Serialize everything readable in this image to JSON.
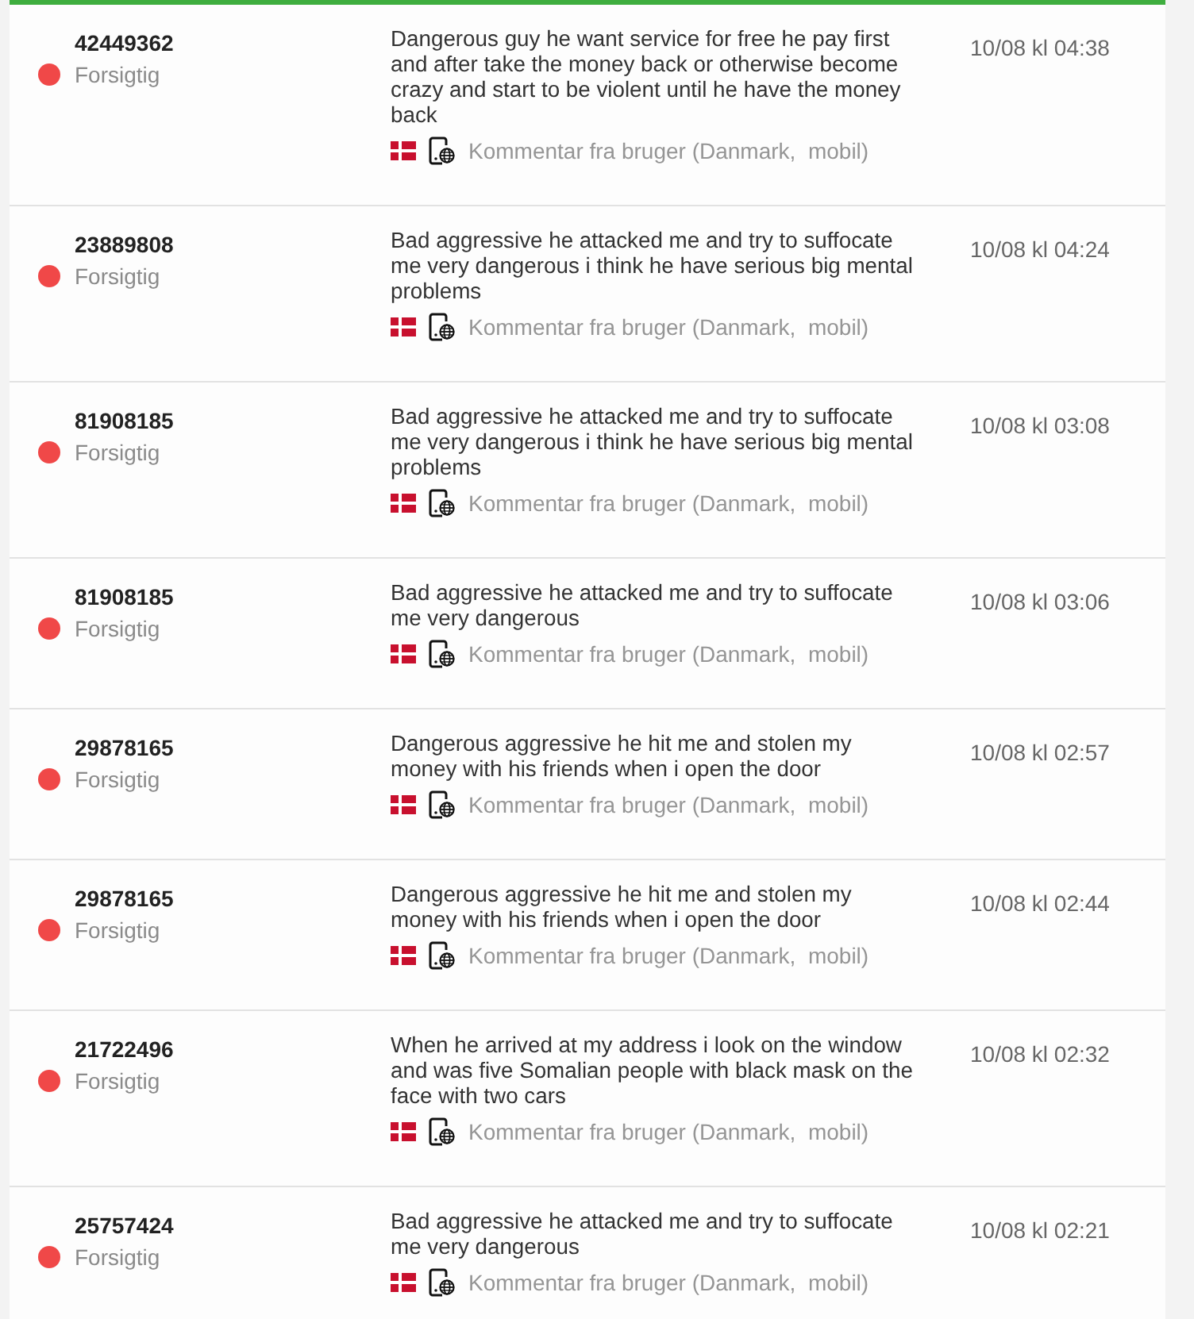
{
  "rows": [
    {
      "id": "42449362",
      "status": {
        "label": "Forsigtig",
        "color": "#f04848"
      },
      "comment": "Dangerous guy he want service for free he pay first and after take the money back or otherwise become crazy and start to be violent until he have the money back",
      "source": "Kommentar fra bruger (Danmark,  mobil)",
      "time": "10/08 kl 04:38"
    },
    {
      "id": "23889808",
      "status": {
        "label": "Forsigtig",
        "color": "#f04848"
      },
      "comment": "Bad aggressive he attacked me and try to suffocate me very dangerous i think he have serious big mental problems",
      "source": "Kommentar fra bruger (Danmark,  mobil)",
      "time": "10/08 kl 04:24"
    },
    {
      "id": "81908185",
      "status": {
        "label": "Forsigtig",
        "color": "#f04848"
      },
      "comment": "Bad aggressive he attacked me and try to suffocate me very dangerous i think he have serious big mental problems",
      "source": "Kommentar fra bruger (Danmark,  mobil)",
      "time": "10/08 kl 03:08"
    },
    {
      "id": "81908185",
      "status": {
        "label": "Forsigtig",
        "color": "#f04848"
      },
      "comment": "Bad aggressive he attacked me and try to suffocate me very dangerous",
      "source": "Kommentar fra bruger (Danmark,  mobil)",
      "time": "10/08 kl 03:06"
    },
    {
      "id": "29878165",
      "status": {
        "label": "Forsigtig",
        "color": "#f04848"
      },
      "comment": "Dangerous aggressive he hit me and stolen my money with his friends when i open the door",
      "source": "Kommentar fra bruger (Danmark,  mobil)",
      "time": "10/08 kl 02:57"
    },
    {
      "id": "29878165",
      "status": {
        "label": "Forsigtig",
        "color": "#f04848"
      },
      "comment": "Dangerous aggressive he hit me and stolen my money with his friends when i open the door",
      "source": "Kommentar fra bruger (Danmark,  mobil)",
      "time": "10/08 kl 02:44"
    },
    {
      "id": "21722496",
      "status": {
        "label": "Forsigtig",
        "color": "#f04848"
      },
      "comment": "When he arrived at my address i look on the window and was five Somalian people with black mask on the face with two cars",
      "source": "Kommentar fra bruger (Danmark,  mobil)",
      "time": "10/08 kl 02:32"
    },
    {
      "id": "25757424",
      "status": {
        "label": "Forsigtig",
        "color": "#f04848"
      },
      "comment": "Bad aggressive he attacked me and try to suffocate me very dangerous",
      "source": "Kommentar fra bruger (Danmark,  mobil)",
      "time": "10/08 kl 02:21"
    }
  ]
}
